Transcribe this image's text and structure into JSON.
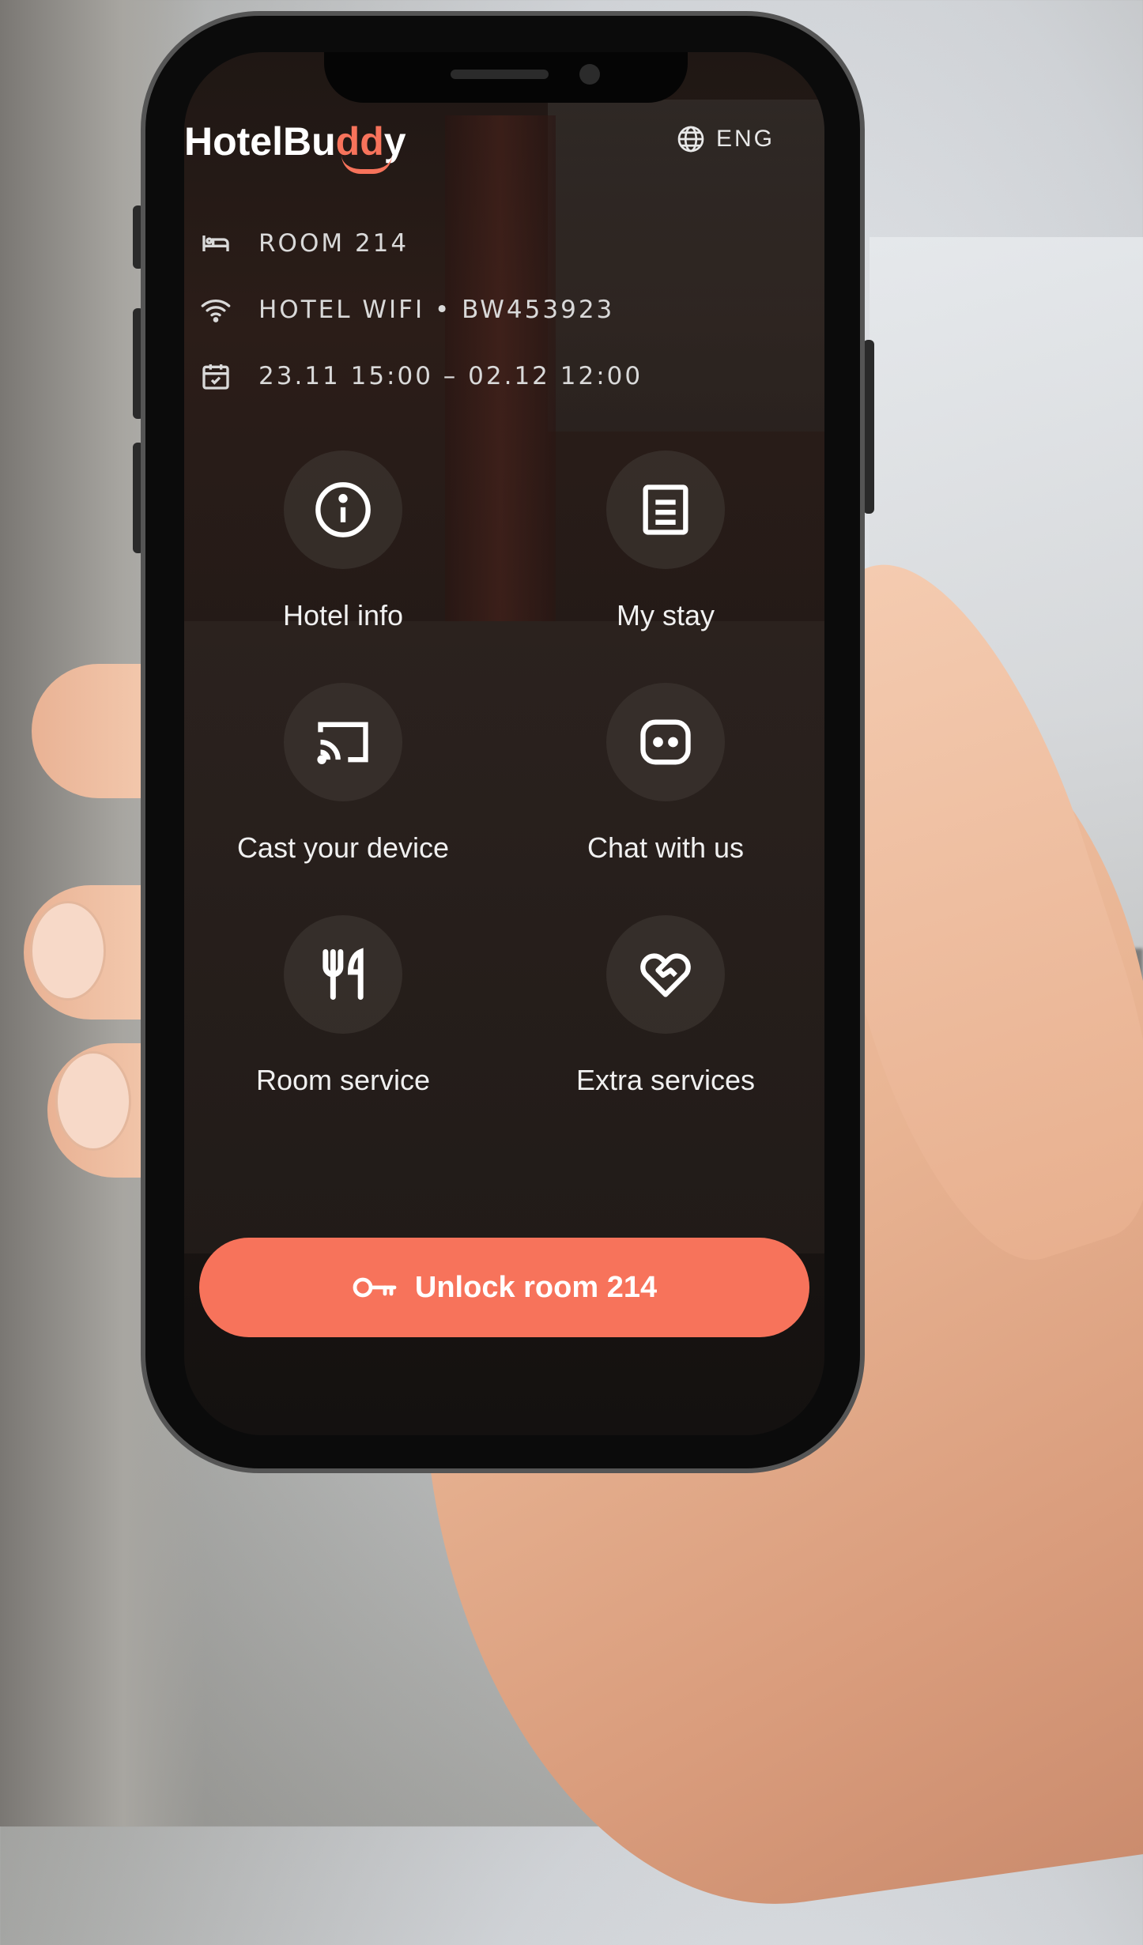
{
  "app": {
    "logo_main": "HotelBu",
    "logo_accent": "dd",
    "logo_end": "y",
    "language": "ENG"
  },
  "info": {
    "room": "ROOM 214",
    "wifi": "HOTEL WIFI • BW453923",
    "dates": "23.11 15:00 – 02.12 12:00"
  },
  "menu": [
    {
      "label": "Hotel info",
      "icon": "info-icon"
    },
    {
      "label": "My stay",
      "icon": "document-icon"
    },
    {
      "label": "Cast your device",
      "icon": "cast-icon"
    },
    {
      "label": "Chat with us",
      "icon": "chat-icon"
    },
    {
      "label": "Room service",
      "icon": "cutlery-icon"
    },
    {
      "label": "Extra services",
      "icon": "heart-handshake-icon"
    }
  ],
  "unlock": {
    "label": "Unlock room 214",
    "icon": "key-icon"
  },
  "colors": {
    "accent": "#f7735b",
    "background": "#1f1714"
  }
}
